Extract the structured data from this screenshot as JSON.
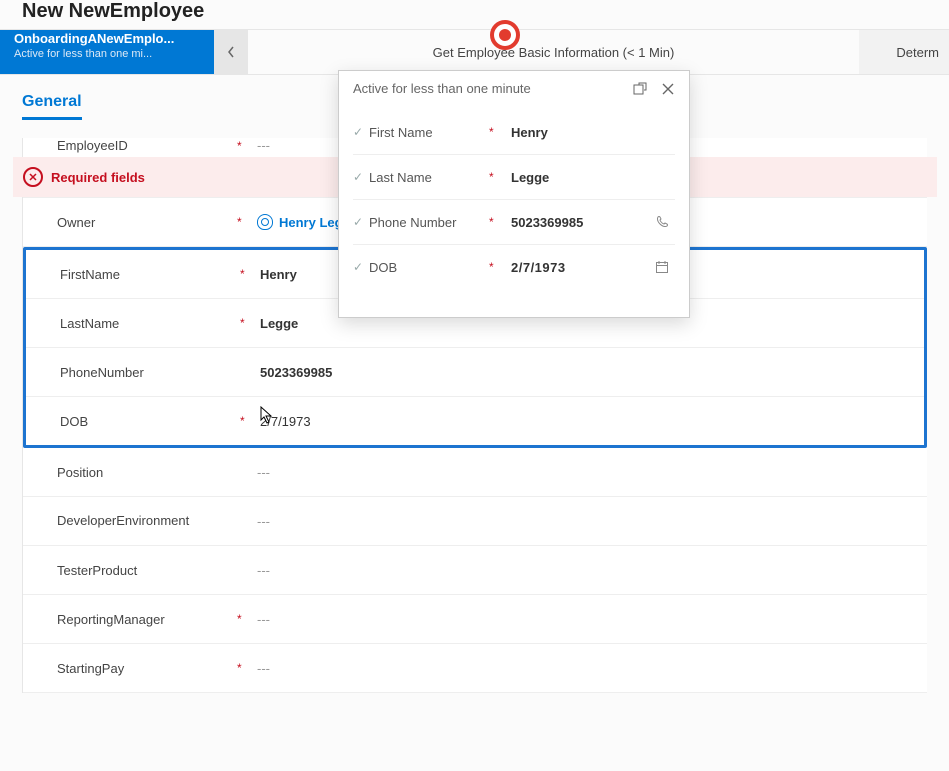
{
  "header": {
    "title": "New NewEmployee"
  },
  "process": {
    "active_title": "OnboardingANewEmplo...",
    "active_sub": "Active for less than one mi...",
    "stage_mid": "Get Employee Basic Information  (< 1 Min)",
    "stage_last": "Determ"
  },
  "tab": {
    "general": "General"
  },
  "fields": {
    "employeeId": {
      "label": "EmployeeID",
      "value": "---",
      "required": "*"
    },
    "errorBanner": "Required fields",
    "owner": {
      "label": "Owner",
      "value": "Henry Legge",
      "required": "*"
    },
    "firstName": {
      "label": "FirstName",
      "value": "Henry",
      "required": "*"
    },
    "lastName": {
      "label": "LastName",
      "value": "Legge",
      "required": "*"
    },
    "phone": {
      "label": "PhoneNumber",
      "value": "5023369985"
    },
    "dob": {
      "label": "DOB",
      "value": "2/7/1973",
      "required": "*"
    },
    "position": {
      "label": "Position",
      "value": "---"
    },
    "devenv": {
      "label": "DeveloperEnvironment",
      "value": "---"
    },
    "tester": {
      "label": "TesterProduct",
      "value": "---"
    },
    "manager": {
      "label": "ReportingManager",
      "value": "---",
      "required": "*"
    },
    "pay": {
      "label": "StartingPay",
      "value": "---",
      "required": "*"
    }
  },
  "flyout": {
    "header": "Active for less than one minute",
    "firstName": {
      "label": "First Name",
      "value": "Henry",
      "required": "*"
    },
    "lastName": {
      "label": "Last Name",
      "value": "Legge",
      "required": "*"
    },
    "phone": {
      "label": "Phone Number",
      "value": "5023369985",
      "required": "*"
    },
    "dob": {
      "label": "DOB",
      "value": "2/7/1973",
      "required": "*"
    }
  }
}
